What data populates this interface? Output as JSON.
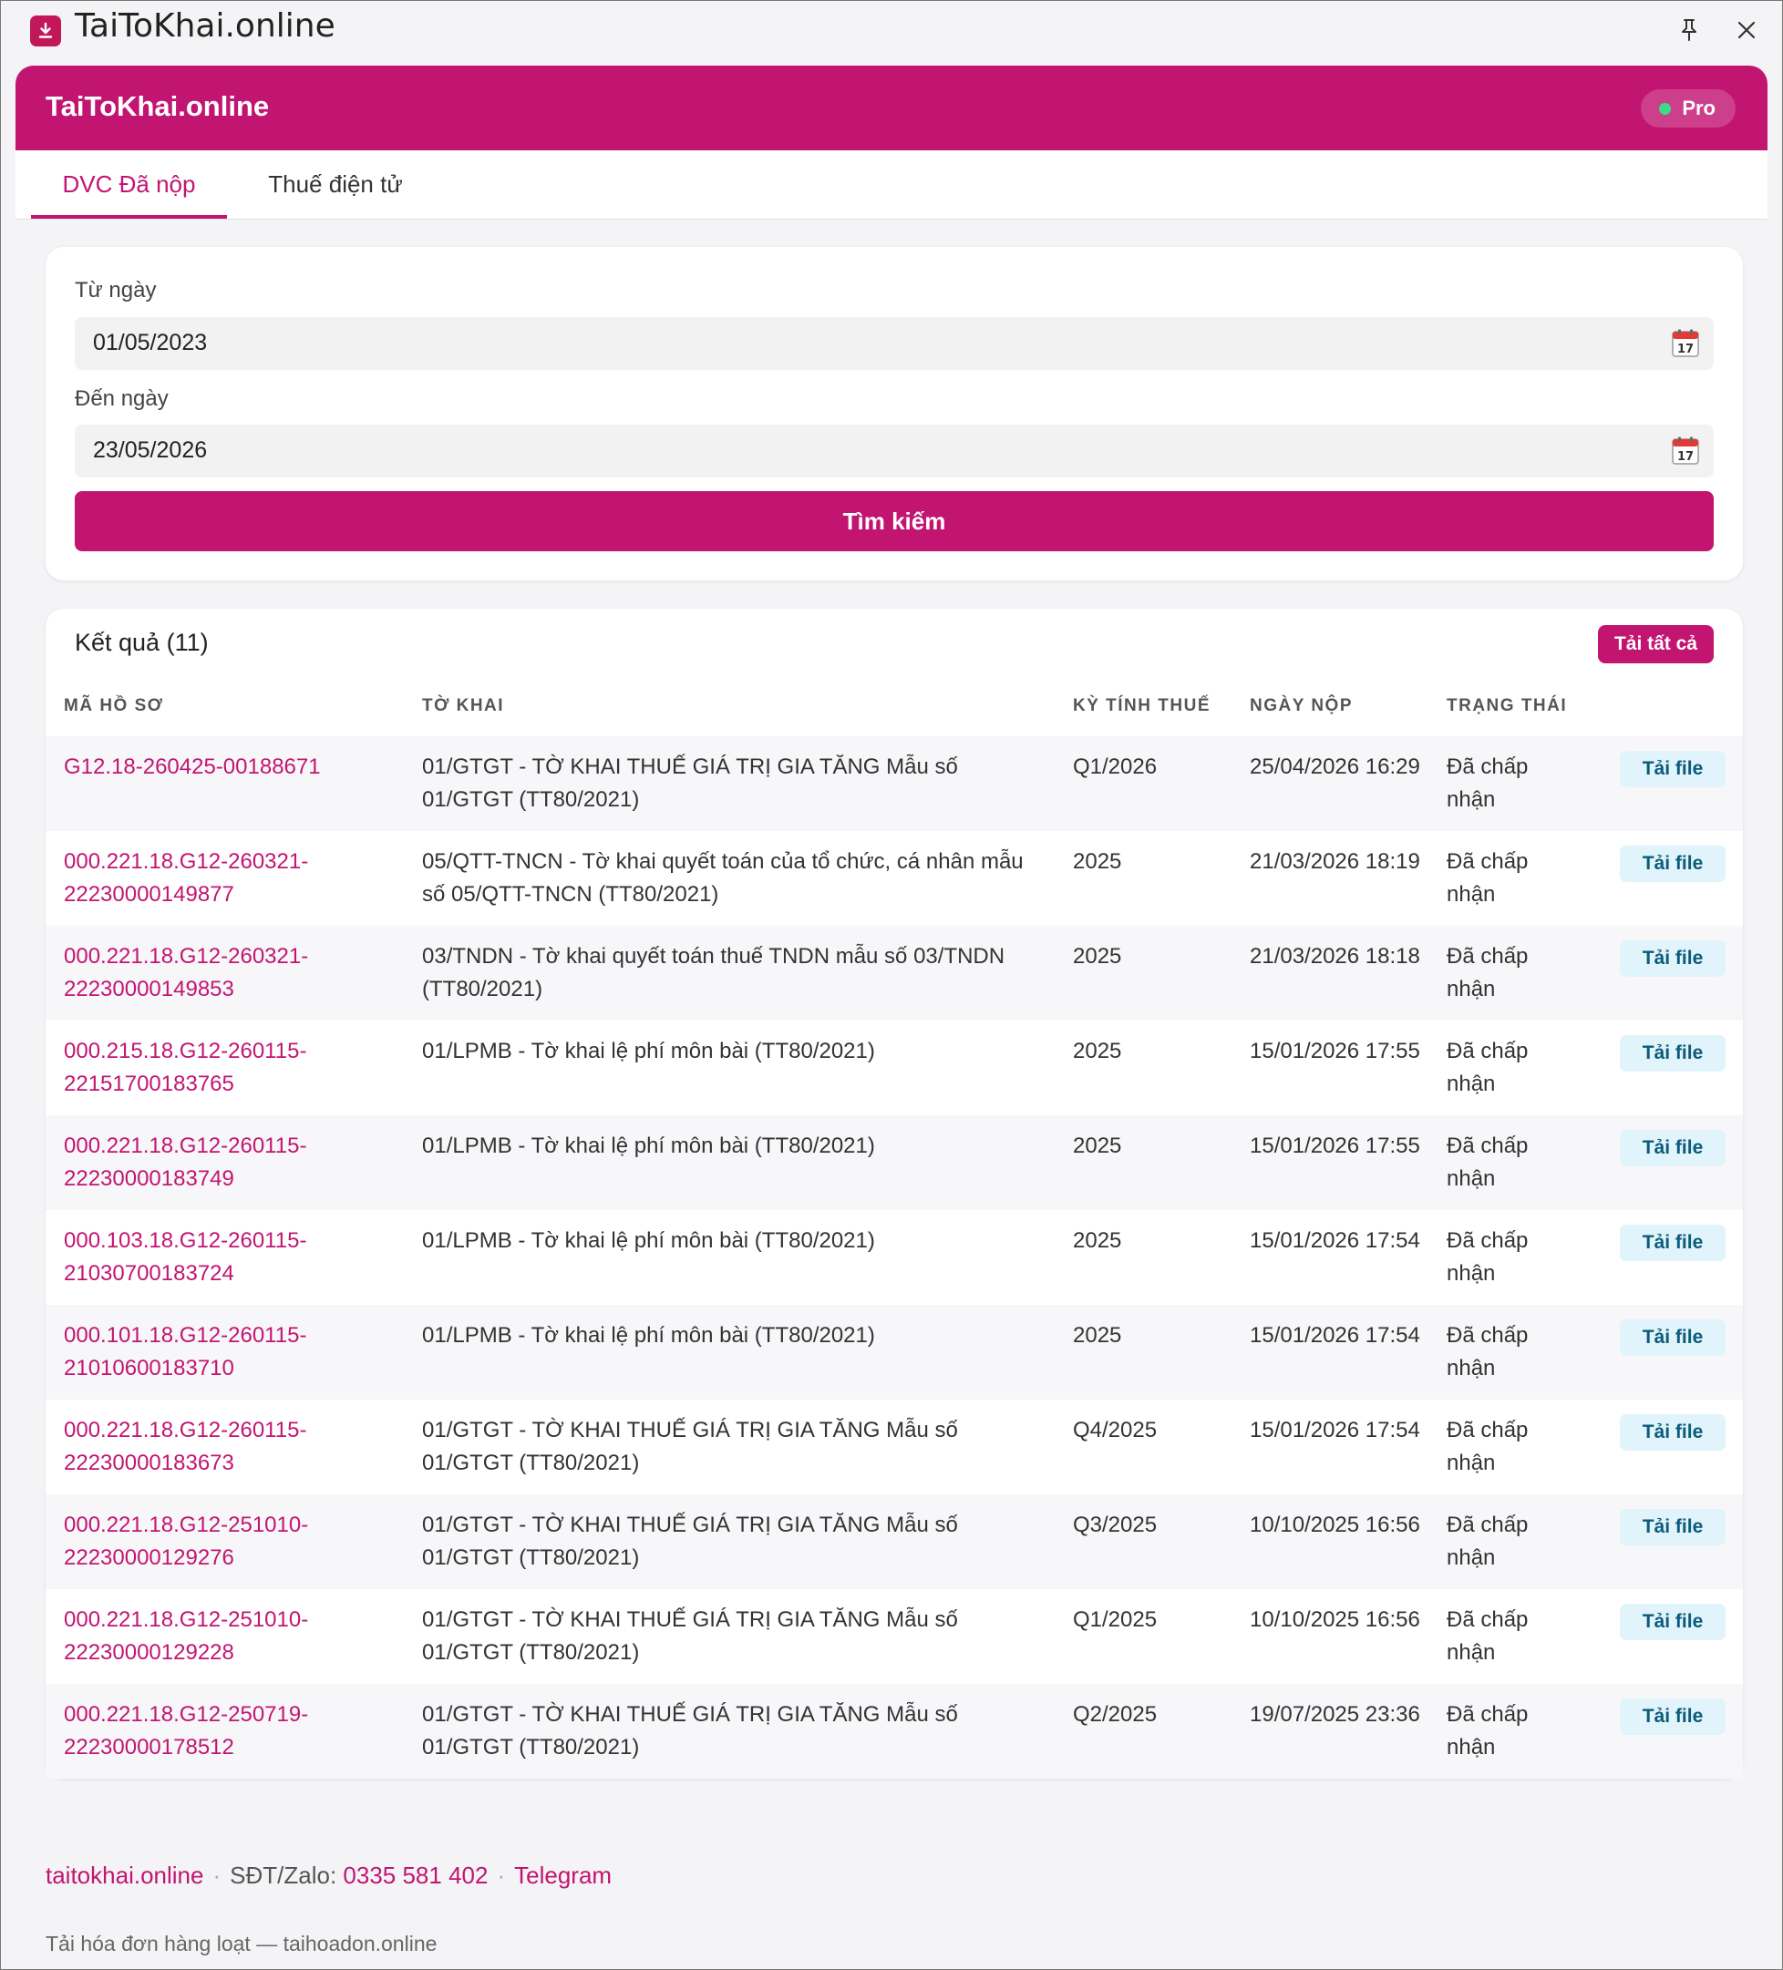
{
  "window": {
    "title": "TaiToKhai.online"
  },
  "header": {
    "title": "TaiToKhai.online",
    "badge": "Pro"
  },
  "tabs": [
    {
      "label": "DVC Đã nộp",
      "active": true
    },
    {
      "label": "Thuế điện tử",
      "active": false
    }
  ],
  "search": {
    "from_label": "Từ ngày",
    "from_value": "01/05/2023",
    "to_label": "Đến ngày",
    "to_value": "23/05/2026",
    "button": "Tìm kiếm"
  },
  "results": {
    "title": "Kết quả (11)",
    "download_all": "Tải tất cả",
    "columns": [
      "MÃ HỒ SƠ",
      "TỜ KHAI",
      "KỲ TÍNH THUẾ",
      "NGÀY NỘP",
      "TRẠNG THÁI"
    ],
    "file_button": "Tải file",
    "rows": [
      {
        "code": "G12.18-260425-00188671",
        "form": "01/GTGT - TỜ KHAI THUẾ GIÁ TRỊ GIA TĂNG Mẫu số 01/GTGT (TT80/2021)",
        "period": "Q1/2026",
        "date": "25/04/2026 16:29",
        "status": "Đã chấp nhận"
      },
      {
        "code": "000.221.18.G12-260321-22230000149877",
        "form": "05/QTT-TNCN - Tờ khai quyết toán của tổ chức, cá nhân mẫu số 05/QTT-TNCN (TT80/2021)",
        "period": "2025",
        "date": "21/03/2026 18:19",
        "status": "Đã chấp nhận"
      },
      {
        "code": "000.221.18.G12-260321-22230000149853",
        "form": "03/TNDN - Tờ khai quyết toán thuế TNDN mẫu số 03/TNDN (TT80/2021)",
        "period": "2025",
        "date": "21/03/2026 18:18",
        "status": "Đã chấp nhận"
      },
      {
        "code": "000.215.18.G12-260115-22151700183765",
        "form": "01/LPMB - Tờ khai lệ phí môn bài (TT80/2021)",
        "period": "2025",
        "date": "15/01/2026 17:55",
        "status": "Đã chấp nhận"
      },
      {
        "code": "000.221.18.G12-260115-22230000183749",
        "form": "01/LPMB - Tờ khai lệ phí môn bài (TT80/2021)",
        "period": "2025",
        "date": "15/01/2026 17:55",
        "status": "Đã chấp nhận"
      },
      {
        "code": "000.103.18.G12-260115-21030700183724",
        "form": "01/LPMB - Tờ khai lệ phí môn bài (TT80/2021)",
        "period": "2025",
        "date": "15/01/2026 17:54",
        "status": "Đã chấp nhận"
      },
      {
        "code": "000.101.18.G12-260115-21010600183710",
        "form": "01/LPMB - Tờ khai lệ phí môn bài (TT80/2021)",
        "period": "2025",
        "date": "15/01/2026 17:54",
        "status": "Đã chấp nhận"
      },
      {
        "code": "000.221.18.G12-260115-22230000183673",
        "form": "01/GTGT - TỜ KHAI THUẾ GIÁ TRỊ GIA TĂNG Mẫu số 01/GTGT (TT80/2021)",
        "period": "Q4/2025",
        "date": "15/01/2026 17:54",
        "status": "Đã chấp nhận"
      },
      {
        "code": "000.221.18.G12-251010-22230000129276",
        "form": "01/GTGT - TỜ KHAI THUẾ GIÁ TRỊ GIA TĂNG Mẫu số 01/GTGT (TT80/2021)",
        "period": "Q3/2025",
        "date": "10/10/2025 16:56",
        "status": "Đã chấp nhận"
      },
      {
        "code": "000.221.18.G12-251010-22230000129228",
        "form": "01/GTGT - TỜ KHAI THUẾ GIÁ TRỊ GIA TĂNG Mẫu số 01/GTGT (TT80/2021)",
        "period": "Q1/2025",
        "date": "10/10/2025 16:56",
        "status": "Đã chấp nhận"
      },
      {
        "code": "000.221.18.G12-250719-22230000178512",
        "form": "01/GTGT - TỜ KHAI THUẾ GIÁ TRỊ GIA TĂNG Mẫu số 01/GTGT (TT80/2021)",
        "period": "Q2/2025",
        "date": "19/07/2025 23:36",
        "status": "Đã chấp nhận"
      }
    ]
  },
  "footer": {
    "site": "taitokhai.online",
    "phone_label": "SĐT/Zalo:",
    "phone": "0335 581 402",
    "telegram": "Telegram",
    "note": "Tải hóa đơn hàng loạt — taihoadon.online"
  },
  "colors": {
    "brand": "#c21572",
    "file_button_bg": "#e1f3fb",
    "badge_dot": "#3ddc84"
  },
  "icons": {
    "app": "download-icon",
    "pin": "pin-icon",
    "close": "close-icon",
    "calendar": "calendar-icon"
  }
}
